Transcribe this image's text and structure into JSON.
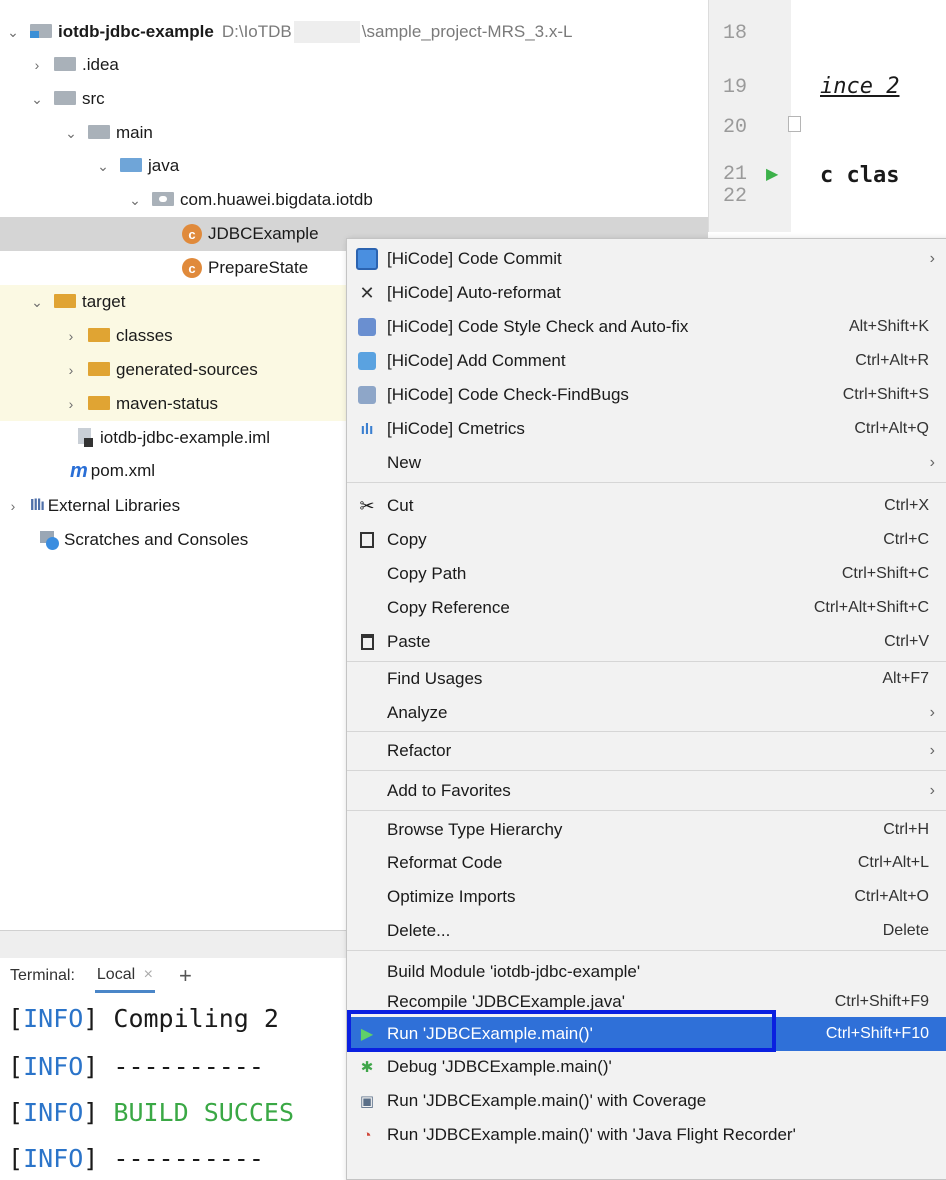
{
  "project": {
    "root_name": "iotdb-jdbc-example",
    "root_path_left": "D:\\IoTDB",
    "root_path_right": "\\sample_project-MRS_3.x-L",
    "items": {
      "idea": ".idea",
      "src": "src",
      "main": "main",
      "java": "java",
      "package": "com.huawei.bigdata.iotdb",
      "class1": "JDBCExample",
      "class2": "PrepareState",
      "target": "target",
      "classes": "classes",
      "generated": "generated-sources",
      "maven_status": "maven-status",
      "iml": "iotdb-jdbc-example.iml",
      "pom": "pom.xml",
      "external_libs": "External Libraries",
      "scratches": "Scratches and Consoles"
    }
  },
  "editor": {
    "lines": [
      "18",
      "19",
      "20",
      "21",
      "22"
    ],
    "code_19": "ince 2",
    "code_21": "c clas"
  },
  "terminal": {
    "label": "Terminal:",
    "tab": "Local",
    "close": "×",
    "add": "+",
    "lines": [
      {
        "tag_open": "[",
        "tag_word": "INFO",
        "tag_close": "]",
        "text": " Compiling 2"
      },
      {
        "tag_open": "[",
        "tag_word": "INFO",
        "tag_close": "]",
        "text": " ----------"
      },
      {
        "tag_open": "[",
        "tag_word": "INFO",
        "tag_close": "]",
        "text": " BUILD SUCCES"
      },
      {
        "tag_open": "[",
        "tag_word": "INFO",
        "tag_close": "]",
        "text": " ----------"
      }
    ]
  },
  "menu": {
    "code_commit": {
      "label": "[HiCode] Code Commit"
    },
    "auto_reformat": {
      "label": "[HiCode] Auto-reformat"
    },
    "style_check": {
      "label": "[HiCode] Code Style Check and Auto-fix",
      "shortcut": "Alt+Shift+K"
    },
    "add_comment": {
      "label": "[HiCode] Add Comment",
      "shortcut": "Ctrl+Alt+R"
    },
    "findbugs": {
      "label": "[HiCode] Code Check-FindBugs",
      "shortcut": "Ctrl+Shift+S"
    },
    "cmetrics": {
      "label": "[HiCode] Cmetrics",
      "shortcut": "Ctrl+Alt+Q"
    },
    "new": {
      "label": "New"
    },
    "cut": {
      "label": "Cut",
      "shortcut": "Ctrl+X"
    },
    "copy": {
      "label": "Copy",
      "shortcut": "Ctrl+C"
    },
    "copy_path": {
      "label": "Copy Path",
      "shortcut": "Ctrl+Shift+C"
    },
    "copy_reference": {
      "label": "Copy Reference",
      "shortcut": "Ctrl+Alt+Shift+C"
    },
    "paste": {
      "label": "Paste",
      "shortcut": "Ctrl+V"
    },
    "find_usages": {
      "label": "Find Usages",
      "shortcut": "Alt+F7"
    },
    "analyze": {
      "label": "Analyze"
    },
    "refactor": {
      "label": "Refactor"
    },
    "add_favorites": {
      "label": "Add to Favorites"
    },
    "browse_hierarchy": {
      "label": "Browse Type Hierarchy",
      "shortcut": "Ctrl+H"
    },
    "reformat_code": {
      "label": "Reformat Code",
      "shortcut": "Ctrl+Alt+L"
    },
    "optimize_imports": {
      "label": "Optimize Imports",
      "shortcut": "Ctrl+Alt+O"
    },
    "delete": {
      "label": "Delete...",
      "shortcut": "Delete"
    },
    "build_module": {
      "label": "Build Module 'iotdb-jdbc-example'"
    },
    "recompile": {
      "label": "Recompile 'JDBCExample.java'",
      "shortcut": "Ctrl+Shift+F9"
    },
    "run": {
      "label": "Run 'JDBCExample.main()'",
      "shortcut": "Ctrl+Shift+F10"
    },
    "debug": {
      "label": "Debug 'JDBCExample.main()'"
    },
    "run_coverage": {
      "label": "Run 'JDBCExample.main()' with Coverage"
    },
    "run_jfr": {
      "label": "Run 'JDBCExample.main()' with 'Java Flight Recorder'"
    },
    "submenu_glyph": "›"
  },
  "icons": {
    "expanded": "⌄",
    "collapsed": "›",
    "class_letter": "c",
    "cut_glyph": "✂",
    "paste_glyph": "📋",
    "run_glyph": "▶",
    "m_letter": "m",
    "libs_glyph": "Illı"
  },
  "colors": {
    "menu_highlight": "#2f70d8",
    "highlight_frame": "#0a20e0",
    "selected_row": "#d5d5d5",
    "excluded_row": "#fbf9e3",
    "success_text": "#3aa845",
    "info_text": "#2b74c9"
  }
}
